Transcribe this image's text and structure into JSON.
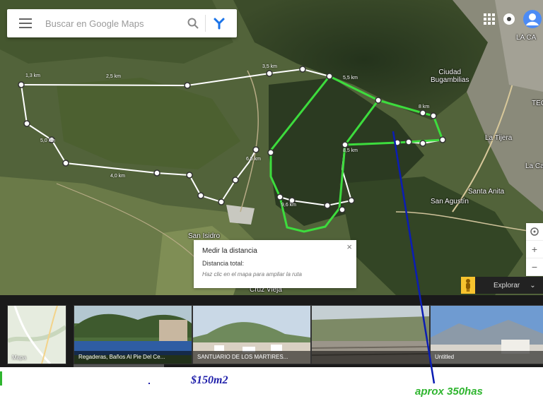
{
  "search": {
    "placeholder": "Buscar en Google Maps",
    "menu_icon": "hamburger-menu-icon",
    "search_icon": "magnifier-icon",
    "directions_icon": "directions-icon"
  },
  "topbar": {
    "apps_icon": "apps-grid-icon",
    "notifications_icon": "notifications-icon",
    "account_icon": "account-avatar-icon"
  },
  "map_labels": {
    "ciudad_bugambilias": "Ciudad\nBugambilias",
    "la_tijera": "La Tijera",
    "santa_anita": "Santa Anita",
    "san_agustin": "San Agustín",
    "san_isidro": "San Isidro",
    "la_calma": "LA CA",
    "cruz_vieja": "Cruz Vieja",
    "tec": "TEC",
    "la_ca_right": "La Ca"
  },
  "segment_labels": [
    "1,3 km",
    "2,5 km",
    "3,5 km",
    "5,0 km",
    "4,0 km",
    "5,5 km",
    "6,5 km",
    "8 km",
    "8,5 km",
    "9,6 km"
  ],
  "popup": {
    "title": "Medir la distancia",
    "distance": "Distancia total:",
    "hint": "Haz clic en el mapa para ampliar la ruta",
    "close_icon": "close-icon"
  },
  "controls": {
    "compass_icon": "compass-icon",
    "zoom_in": "+",
    "zoom_out": "−",
    "explore_label": "Explorar",
    "pegman_icon": "pegman-icon",
    "chevron_icon": "chevron-down-icon"
  },
  "photos": [
    {
      "caption": "Mapa"
    },
    {
      "caption": "Regaderas, Baños Al Pie Del Ce..."
    },
    {
      "caption": "SANTUARIO DE LOS MARTIRES..."
    },
    {
      "caption": ""
    },
    {
      "caption": "Untitled"
    }
  ],
  "annotations": {
    "price": "$150m2",
    "area": "aprox 350has"
  },
  "colors": {
    "polygon": "#3ddc3d",
    "annotation_line": "#0b1db3",
    "price_text": "#1f1faa",
    "area_text": "#2fb52f",
    "measure_line": "#ffffff"
  }
}
